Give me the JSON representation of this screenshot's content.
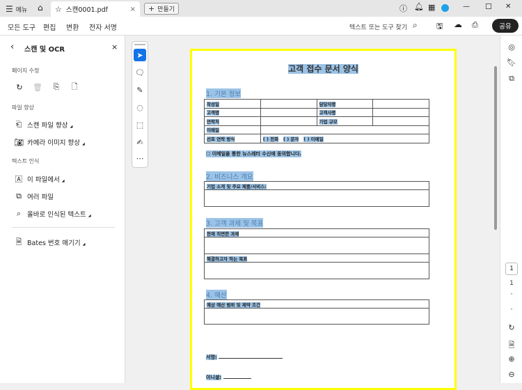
{
  "titlebar": {
    "menu": "메뉴",
    "tab_title": "스캔0001.pdf",
    "tab_close": "×",
    "create": "만들기",
    "minimize": "—",
    "maximize": "☐",
    "close": "✕"
  },
  "toolbar": {
    "tabs": [
      "모든 도구",
      "편집",
      "변환",
      "전자 서명"
    ],
    "active_tab": "변환",
    "search": "텍스트 또는 도구 찾기",
    "share": "공유"
  },
  "panel": {
    "title": "스캔 및 OCR",
    "close": "×",
    "sections": [
      {
        "label": "페이지 수정"
      },
      {
        "label": "파일 향상",
        "items": [
          "스캔 파일 향상",
          "카메라 이미지 향상"
        ]
      },
      {
        "label": "텍스트 인식",
        "items": [
          "이 파일에서",
          "여러 파일",
          "올바로 인식된 텍스트"
        ]
      }
    ],
    "bates": "Bates 번호 매기기"
  },
  "document": {
    "title": "고객 접수 문서 양식",
    "s1": "1. 기본 정보",
    "rows": [
      [
        "작성일",
        "",
        "담당자명",
        ""
      ],
      [
        "고객명",
        "",
        "고객사명",
        ""
      ],
      [
        "연락처",
        "",
        "기업 규모",
        ""
      ]
    ],
    "email": "이메일",
    "contact_label": "선호 연락 방식",
    "contact_opts": [
      "( ) 전화",
      "( ) 문자",
      "( ) 이메일"
    ],
    "consent": "☐ 이메일을 통한 뉴스레터 수신에 동의합니다.",
    "s2": "2. 비즈니스 개요",
    "s2_box": "기업 소개 및 주요 제품/서비스:",
    "s3": "3. 고객 과제 및 목표",
    "s3_box1": "현재 직면한 과제",
    "s3_box2": "해결하고자 하는 목표",
    "s4": "4. 예산",
    "s4_box": "예상 예산 범위 및 제약 조건",
    "sign": "서명:",
    "initial": "이니셜:"
  },
  "pagenav": {
    "current": "1",
    "total": "1"
  },
  "colors": {
    "accent": "#1473e6",
    "highlight": "#9cc3e6",
    "selection_border": "#ffff00"
  }
}
